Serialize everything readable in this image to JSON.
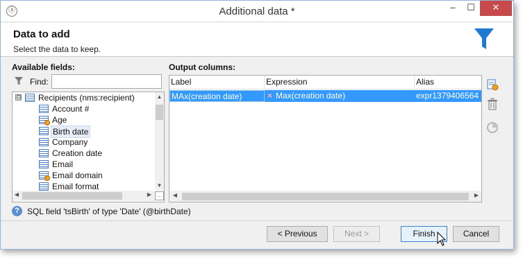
{
  "window": {
    "title": "Additional data *",
    "minimize_glyph": "–",
    "maximize_glyph": "☐",
    "close_glyph": "✕"
  },
  "header": {
    "title": "Data to add",
    "subtitle": "Select the data to keep.",
    "icon": "funnel-icon",
    "accent_color": "#1f7ad1"
  },
  "available_fields": {
    "label": "Available fields:",
    "find_label": "Find:",
    "find_value": "",
    "tree": {
      "root": {
        "label": "Recipients (nms:recipient)",
        "expander": "⊟",
        "icon": "list-icon"
      },
      "items": [
        {
          "label": "Account #",
          "icon": "list-icon"
        },
        {
          "label": "Age",
          "icon": "calculated-field-icon"
        },
        {
          "label": "Birth date",
          "icon": "list-icon",
          "selected": true
        },
        {
          "label": "Company",
          "icon": "list-icon"
        },
        {
          "label": "Creation date",
          "icon": "list-icon"
        },
        {
          "label": "Email",
          "icon": "list-icon"
        },
        {
          "label": "Email domain",
          "icon": "calculated-field-icon"
        },
        {
          "label": "Email format",
          "icon": "list-icon"
        }
      ]
    }
  },
  "output_columns": {
    "label": "Output columns:",
    "headers": [
      "Label",
      "Expression",
      "Alias"
    ],
    "rows": [
      {
        "label": "MAx(creation date)",
        "expression": "Max(creation date)",
        "alias": "expr1379406564",
        "selected": true
      }
    ]
  },
  "side_tools": [
    "add-column-icon",
    "delete-icon",
    "distribution-icon"
  ],
  "status": {
    "help_glyph": "?",
    "text": "SQL field 'tsBirth' of type 'Date' (@birthDate)"
  },
  "buttons": {
    "previous": "< Previous",
    "next": "Next >",
    "finish": "Finish",
    "cancel": "Cancel"
  }
}
